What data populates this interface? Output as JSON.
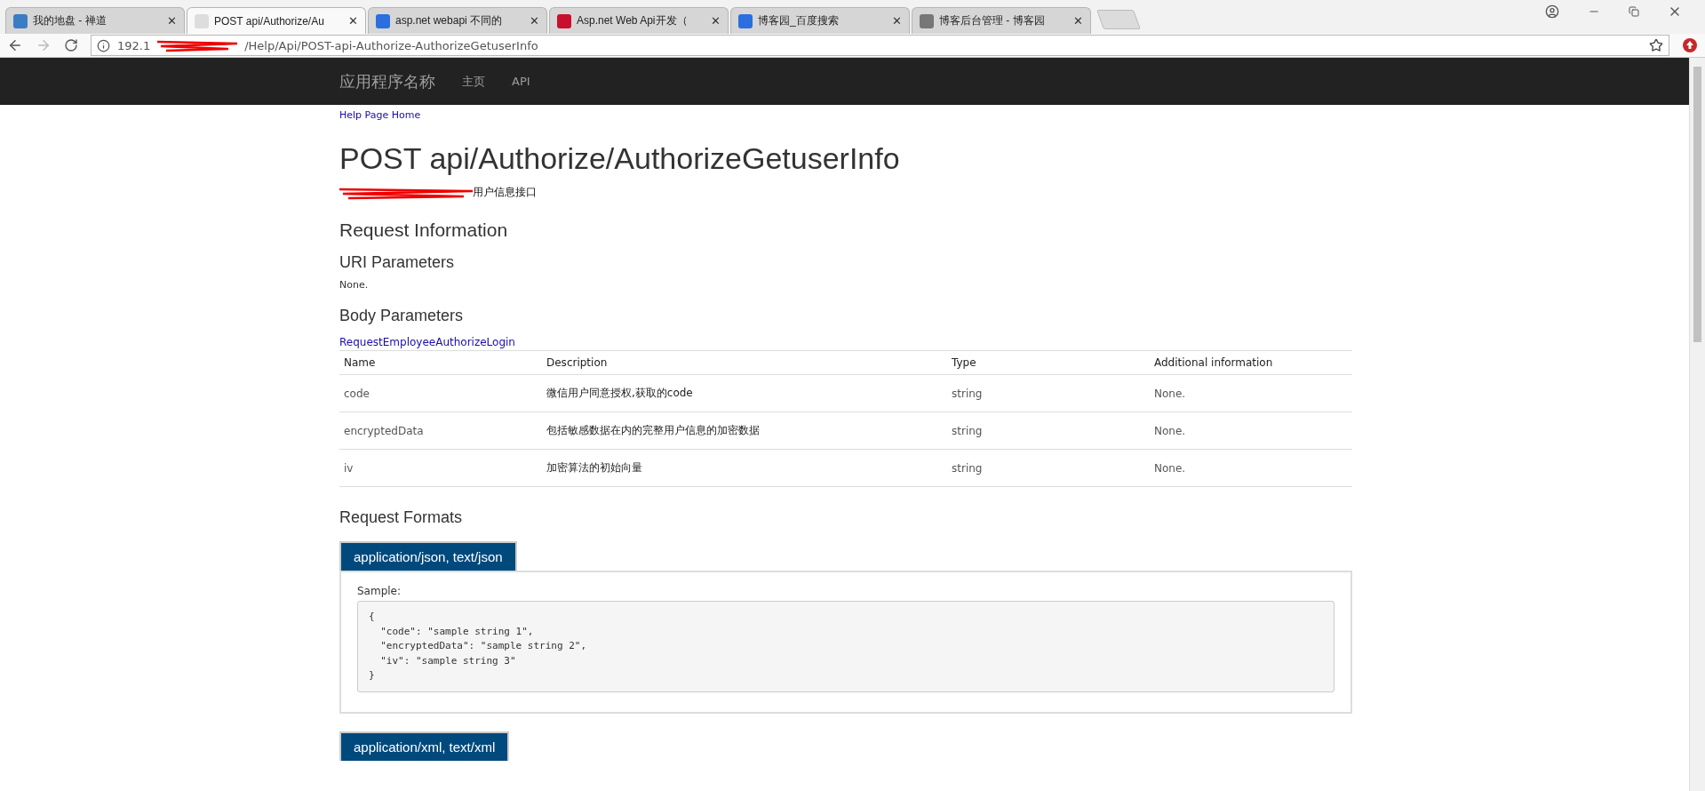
{
  "browser": {
    "tabs": [
      {
        "title": "我的地盘 - 禅道",
        "selected": false,
        "close": "✕"
      },
      {
        "title": "POST api/Authorize/Au",
        "selected": true,
        "close": "✕"
      },
      {
        "title": "asp.net webapi 不同的",
        "selected": false,
        "close": "✕"
      },
      {
        "title": "Asp.net Web Api开发（",
        "selected": false,
        "close": "✕"
      },
      {
        "title": "博客园_百度搜索",
        "selected": false,
        "close": "✕"
      },
      {
        "title": "博客后台管理 - 博客园",
        "selected": false,
        "close": "✕"
      }
    ],
    "url_start": "192.1",
    "url_visible": "/Help/Api/POST-api-Authorize-AuthorizeGetuserInfo"
  },
  "navbar": {
    "brand": "应用程序名称",
    "links": [
      "主页",
      "API"
    ]
  },
  "breadcrumb": "Help Page Home",
  "title": "POST api/Authorize/AuthorizeGetuserInfo",
  "description_visible": "用户信息接口",
  "sections": {
    "request_information": "Request Information",
    "uri_parameters": "URI Parameters",
    "uri_none": "None.",
    "body_parameters": "Body Parameters",
    "body_type_link": "RequestEmployeeAuthorizeLogin",
    "request_formats": "Request Formats"
  },
  "table": {
    "columns": [
      "Name",
      "Description",
      "Type",
      "Additional information"
    ],
    "rows": [
      [
        "code",
        "微信用户同意授权,获取的code",
        "string",
        "None."
      ],
      [
        "encryptedData",
        "包括敏感数据在内的完整用户信息的加密数据",
        "string",
        "None."
      ],
      [
        "iv",
        "加密算法的初始向量",
        "string",
        "None."
      ]
    ]
  },
  "formats": [
    {
      "label": "application/json, text/json",
      "sample_label": "Sample:",
      "sample": "{\n  \"code\": \"sample string 1\",\n  \"encryptedData\": \"sample string 2\",\n  \"iv\": \"sample string 3\"\n}"
    },
    {
      "label": "application/xml, text/xml"
    }
  ]
}
